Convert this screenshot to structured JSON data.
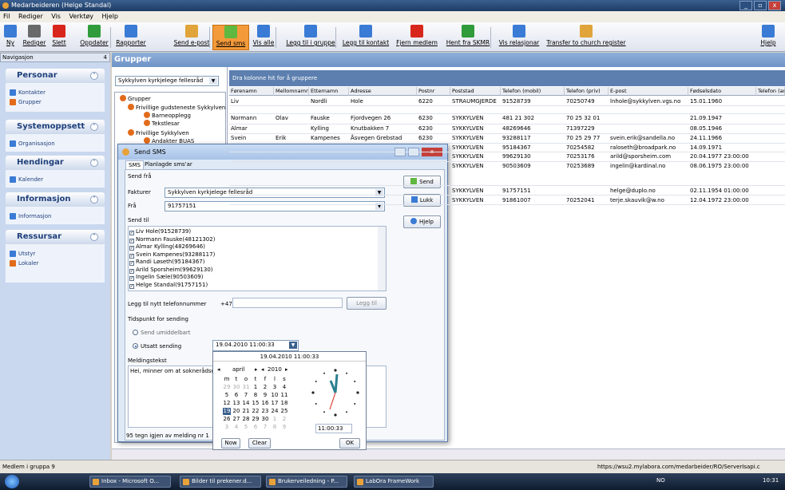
{
  "window": {
    "title": "Medarbeideren (Helge Standal)",
    "controls": [
      "_",
      "▫",
      "x"
    ]
  },
  "menu": [
    "Fil",
    "Rediger",
    "Vis",
    "Verktøy",
    "Hjelp"
  ],
  "toolbar": {
    "buttons": [
      {
        "label": "Ny",
        "color": "#3a7bd5"
      },
      {
        "label": "Rediger",
        "color": "#6a6a6a"
      },
      {
        "label": "Slett",
        "color": "#d9261c"
      },
      {
        "label": "Oppdater",
        "color": "#2f9b3a"
      },
      {
        "label": "Rapporter",
        "color": "#3a7bd5"
      },
      {
        "label": "Send e-post",
        "color": "#e0a43a"
      },
      {
        "label": "Send sms",
        "color": "#5fb83f"
      },
      {
        "label": "Vis alle",
        "color": "#3a7bd5"
      },
      {
        "label": "Legg til i gruppe",
        "color": "#3a7bd5"
      },
      {
        "label": "Legg til kontakt",
        "color": "#3a7bd5"
      },
      {
        "label": "Fjern medlem",
        "color": "#d9261c"
      },
      {
        "label": "Hent fra SKMR",
        "color": "#2f9b3a"
      },
      {
        "label": "Vis relasjonar",
        "color": "#3a7bd5"
      },
      {
        "label": "Transfer to church register",
        "color": "#e0a43a"
      },
      {
        "label": "Hjelp",
        "color": "#3a7bd5"
      }
    ],
    "active": "Send sms"
  },
  "nav": {
    "header": "Navigasjon",
    "pin": "4",
    "groups": [
      {
        "title": "Personar",
        "items": [
          "Kontakter",
          "Grupper"
        ]
      },
      {
        "title": "Systemoppsett",
        "items": [
          "Organisasjon"
        ]
      },
      {
        "title": "Hendingar",
        "items": [
          "Kalender"
        ]
      },
      {
        "title": "Informasjon",
        "items": [
          "Informasjon"
        ]
      },
      {
        "title": "Ressursar",
        "items": [
          "Utstyr",
          "Lokaler"
        ]
      }
    ]
  },
  "main": {
    "title": "Grupper",
    "org_select": "Sykkylven kyrkjelege fellesråd",
    "group_hint": "Dra kolonne hit for å gruppere"
  },
  "tree": [
    "Grupper",
    "Frivillige gudsteneste Sykkylven",
    "Barneopplegg",
    "Tekstlesar",
    "Frivillige Sykkylven",
    "Andakter BUAS"
  ],
  "grid": {
    "columns": [
      "Førenamn",
      "Mellomnamn",
      "Etternamn",
      "Adresse",
      "Postnr",
      "Poststad",
      "Telefon (mobil)",
      "Telefon (priv)",
      "E-post",
      "Fødselsdato",
      "Telefon (arb)"
    ],
    "rows": [
      [
        "Liv",
        "",
        "Nordli",
        "Hole",
        "6220",
        "STRAUMGJERDE",
        "91528739",
        "70250749",
        "lnhole@sykkylven.vgs.no",
        "15.01.1960",
        ""
      ],
      [
        "Normann",
        "Olav",
        "Fauske",
        "Fjordvegen 26",
        "6230",
        "SYKKYLVEN",
        "481 21 302",
        "70 25 32 01",
        "",
        "21.09.1947",
        ""
      ],
      [
        "Almar",
        "",
        "Kylling",
        "Knutbakken 7",
        "6230",
        "SYKKYLVEN",
        "48269646",
        "71397229",
        "",
        "08.05.1946",
        ""
      ],
      [
        "Svein",
        "Erik",
        "Kampenes",
        "Åsvegen Grebstad",
        "6230",
        "SYKKYLVEN",
        "93288117",
        "70 25 29 77",
        "svein.erik@sandella.no",
        "24.11.1966",
        ""
      ],
      [
        "",
        "",
        "",
        "",
        "",
        "SYKKYLVEN",
        "95184367",
        "70254582",
        "raloseth@broadpark.no",
        "14.09.1971",
        ""
      ],
      [
        "",
        "",
        "",
        "",
        "",
        "SYKKYLVEN",
        "99629130",
        "70253176",
        "arild@sporsheim.com",
        "20.04.1977 23:00:00",
        ""
      ],
      [
        "",
        "",
        "",
        "",
        "",
        "SYKKYLVEN",
        "90503609",
        "70253689",
        "ingelin@kardinal.no",
        "08.06.1975 23:00:00",
        ""
      ],
      [
        "",
        "",
        "",
        "",
        "",
        "SYKKYLVEN",
        "91757151",
        "",
        "helge@duplo.no",
        "02.11.1954 01:00:00",
        ""
      ],
      [
        "",
        "",
        "",
        "",
        "",
        "SYKKYLVEN",
        "91861007",
        "70252041",
        "terje.skauvik@w.no",
        "12.04.1972 23:00:00",
        ""
      ]
    ]
  },
  "dialog": {
    "title": "Send SMS",
    "tabs": [
      "SMS",
      "Planlagde sms'ar"
    ],
    "send_from_label": "Send frå",
    "fakturer_label": "Fakturer",
    "fakturer_value": "Sykkylven kyrkjelege fellesråd",
    "fra_label": "Frå",
    "fra_value": "91757151",
    "send_button": "Send",
    "close_button": "Lukk",
    "help_button": "Hjelp",
    "send_to_label": "Send til",
    "recipients": [
      "Liv Hole(91528739)",
      "Normann Fauske(48121302)",
      "Almar Kylling(48269646)",
      "Svein Kampenes(93288117)",
      "Randi Løseth(95184367)",
      "Arild Sporsheim(99629130)",
      "Ingelin Sæle(90503609)",
      "Helge Standal(91757151)"
    ],
    "new_number_label": "Legg til nytt telefonnummer",
    "country_code": "+47",
    "add_button": "Legg til",
    "timing_label": "Tidspunkt for sending",
    "send_now": "Send umiddelbart",
    "send_later": "Utsatt sending",
    "datetime": "19.04.2010 11:00:33",
    "message_label": "Meldingstekst",
    "message": "Hei, minner om at soknerådsmøt",
    "status": "95 tegn igjen av melding nr 1"
  },
  "calendar": {
    "header": "19.04.2010 11:00:33",
    "month": "april",
    "year": "2010",
    "weekdays": [
      "m",
      "t",
      "o",
      "t",
      "f",
      "l",
      "s"
    ],
    "days": [
      [
        "29",
        "30",
        "31",
        "1",
        "2",
        "3",
        "4"
      ],
      [
        "5",
        "6",
        "7",
        "8",
        "9",
        "10",
        "11"
      ],
      [
        "12",
        "13",
        "14",
        "15",
        "16",
        "17",
        "18"
      ],
      [
        "19",
        "20",
        "21",
        "22",
        "23",
        "24",
        "25"
      ],
      [
        "26",
        "27",
        "28",
        "29",
        "30",
        "1",
        "2"
      ],
      [
        "3",
        "4",
        "5",
        "6",
        "7",
        "8",
        "9"
      ]
    ],
    "selected_day": "19",
    "time": "11:00:33",
    "now_button": "Now",
    "clear_button": "Clear",
    "ok_button": "OK"
  },
  "statusbar": {
    "left": "Medlem i gruppa 9",
    "right": "https://wsu2.mylabora.com/medarbeider/RO/ServerIsapi.c"
  },
  "taskbar": {
    "tasks": [
      "Inbox - Microsoft O...",
      "Bilder til prekener.d...",
      "Brukerveiledning - P...",
      "LabOra FrameWork"
    ],
    "lang": "NO",
    "clock": "10:31"
  },
  "colors": {
    "accent": "#f39a3a",
    "nav_bg": "#c9d8ee",
    "header": "#6e93c6"
  }
}
